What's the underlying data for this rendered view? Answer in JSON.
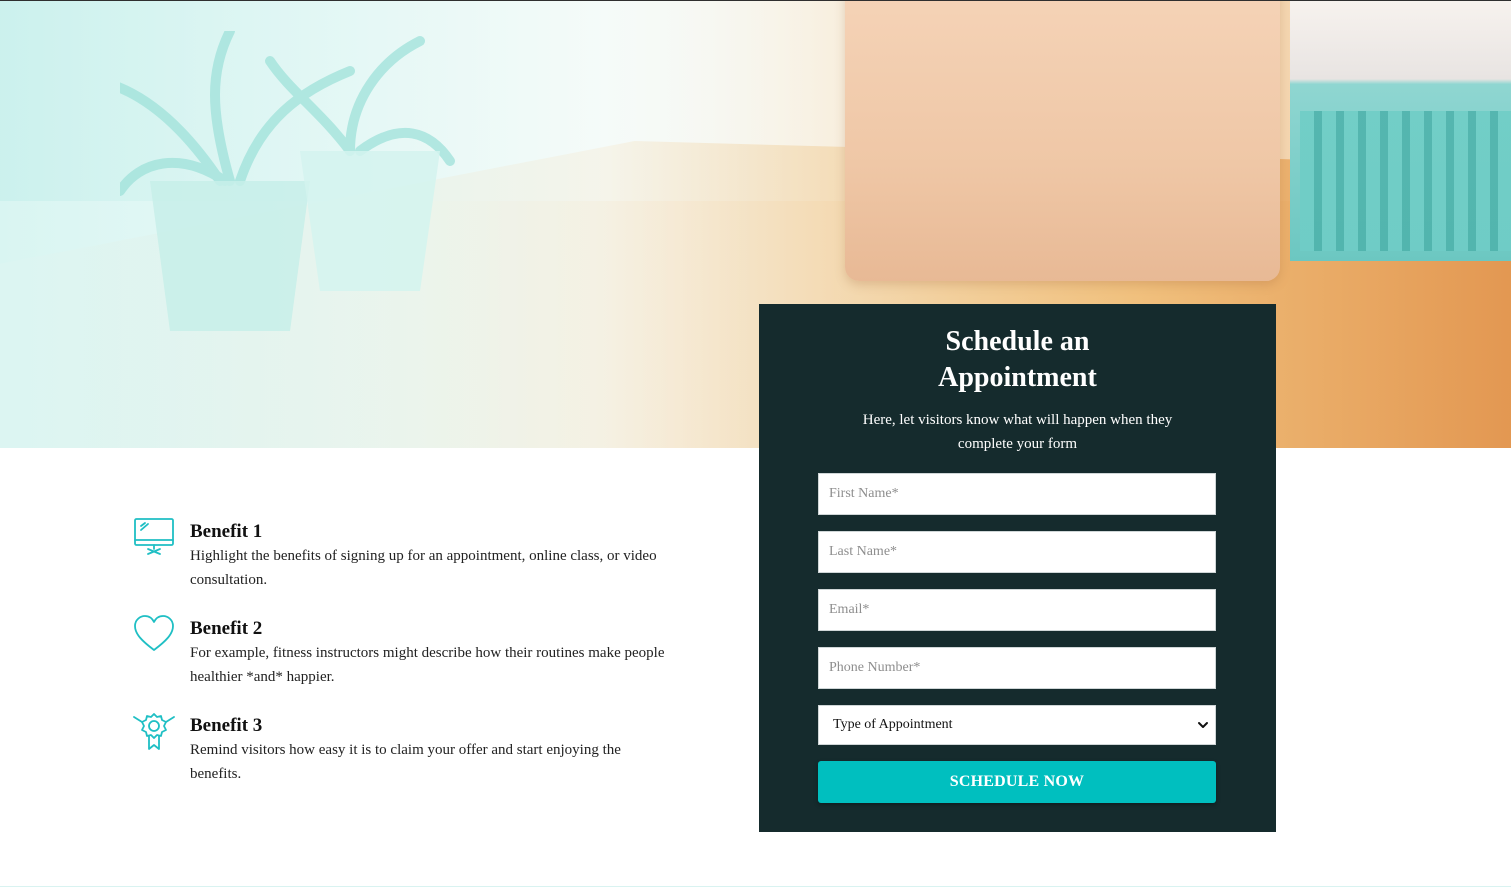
{
  "hero": {
    "image": "office desk with plants and laptop"
  },
  "benefits": [
    {
      "icon": "monitor-icon",
      "title": "Benefit 1",
      "desc_line1": "Highlight the benefits of signing up for an appointment, online class, or video",
      "desc_line2": "consultation."
    },
    {
      "icon": "heart-icon",
      "title": "Benefit 2",
      "desc_line1": "For example, fitness instructors might describe how their routines make people",
      "desc_line2": "healthier *and* happier."
    },
    {
      "icon": "award-ribbon-icon",
      "title": "Benefit 3",
      "desc_line1": "Remind visitors how easy it is to claim your offer and start enjoying the",
      "desc_line2": "benefits."
    }
  ],
  "form": {
    "title": "Schedule an Appointment",
    "subtitle": "Here, let visitors know what will happen when they complete your form",
    "first_name_placeholder": "First Name*",
    "last_name_placeholder": "Last Name*",
    "email_placeholder": "Email*",
    "phone_placeholder": "Phone Number*",
    "appointment_type_selected": "Type of Appointment",
    "submit_label": "SCHEDULE NOW"
  },
  "colors": {
    "accent": "#00bfbf",
    "panel_bg": "#152b2d",
    "icon": "#1fbfc4"
  }
}
